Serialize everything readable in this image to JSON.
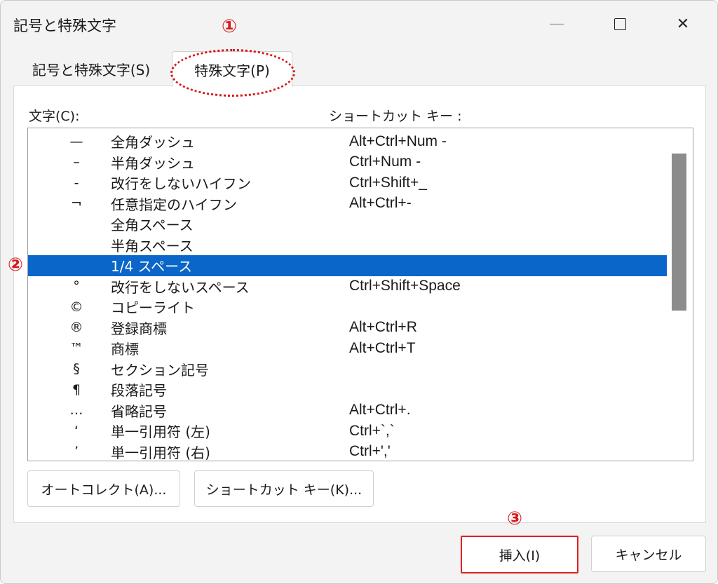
{
  "window": {
    "title": "記号と特殊文字",
    "minimize_icon": "—",
    "maximize_icon": "square",
    "close_icon": "✕"
  },
  "tabs": [
    {
      "label": "記号と特殊文字(S)",
      "active": false
    },
    {
      "label": "特殊文字(P)",
      "active": true
    }
  ],
  "columns": {
    "char": "文字(C):",
    "shortcut": "ショートカット キー :"
  },
  "rows": [
    {
      "symbol": "—",
      "name": "全角ダッシュ",
      "shortcut": "Alt+Ctrl+Num -"
    },
    {
      "symbol": "–",
      "name": "半角ダッシュ",
      "shortcut": "Ctrl+Num -"
    },
    {
      "symbol": "-",
      "name": "改行をしないハイフン",
      "shortcut": "Ctrl+Shift+_"
    },
    {
      "symbol": "¬",
      "name": "任意指定のハイフン",
      "shortcut": "Alt+Ctrl+-"
    },
    {
      "symbol": "",
      "name": "全角スペース",
      "shortcut": ""
    },
    {
      "symbol": "",
      "name": "半角スペース",
      "shortcut": ""
    },
    {
      "symbol": "",
      "name": "1/4 スペース",
      "shortcut": "",
      "selected": true
    },
    {
      "symbol": "°",
      "name": "改行をしないスペース",
      "shortcut": "Ctrl+Shift+Space"
    },
    {
      "symbol": "©",
      "name": "コピーライト",
      "shortcut": ""
    },
    {
      "symbol": "®",
      "name": "登録商標",
      "shortcut": "Alt+Ctrl+R"
    },
    {
      "symbol": "™",
      "name": "商標",
      "shortcut": "Alt+Ctrl+T"
    },
    {
      "symbol": "§",
      "name": "セクション記号",
      "shortcut": ""
    },
    {
      "symbol": "¶",
      "name": "段落記号",
      "shortcut": ""
    },
    {
      "symbol": "…",
      "name": "省略記号",
      "shortcut": "Alt+Ctrl+."
    },
    {
      "symbol": "‘",
      "name": "単一引用符 (左)",
      "shortcut": "Ctrl+`,`"
    },
    {
      "symbol": "’",
      "name": "単一引用符 (右)",
      "shortcut": "Ctrl+','"
    }
  ],
  "buttons": {
    "autocorrect": "オートコレクト(A)...",
    "shortcut_key": "ショートカット キー(K)...",
    "insert": "挿入(I)",
    "cancel": "キャンセル"
  },
  "annotations": [
    "①",
    "②",
    "③"
  ],
  "colors": {
    "selection": "#0a66c8",
    "annotation": "#d8171b"
  }
}
